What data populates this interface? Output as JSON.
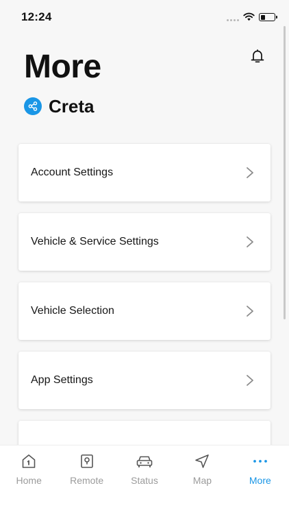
{
  "status_bar": {
    "time": "12:24"
  },
  "header": {
    "title": "More",
    "bell_icon": "bell-icon"
  },
  "vehicle": {
    "name": "Creta",
    "icon": "share-icon",
    "icon_color": "#1a96e6"
  },
  "menu": {
    "items": [
      {
        "label": "Account Settings"
      },
      {
        "label": "Vehicle & Service Settings"
      },
      {
        "label": "Vehicle Selection"
      },
      {
        "label": "App Settings"
      },
      {
        "label": ""
      }
    ]
  },
  "tab_bar": {
    "active_color": "#1a96e6",
    "inactive_color": "#9b9b9b",
    "tabs": [
      {
        "label": "Home",
        "icon": "home-icon"
      },
      {
        "label": "Remote",
        "icon": "remote-icon"
      },
      {
        "label": "Status",
        "icon": "car-icon"
      },
      {
        "label": "Map",
        "icon": "navigation-arrow-icon"
      },
      {
        "label": "More",
        "icon": "more-dots-icon",
        "active": true
      }
    ]
  }
}
